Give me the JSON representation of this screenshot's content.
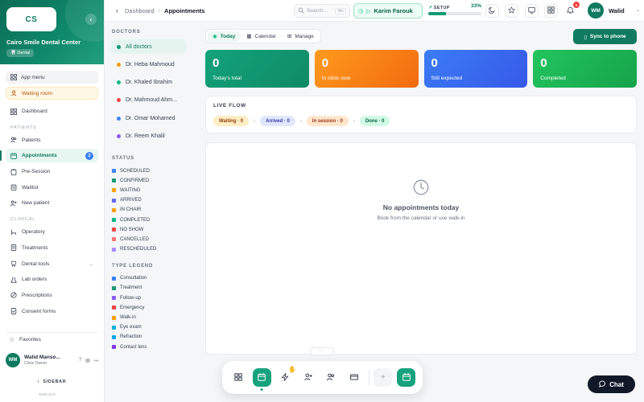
{
  "brand": {
    "logo_initials": "CS",
    "clinic_name": "Cairo Smile Dental Center",
    "badge": "Dental"
  },
  "sidebar": {
    "app_menu": "App menu",
    "waiting_room": "Waiting room",
    "dashboard": "Dashboard",
    "section_patients": "PATIENTS",
    "patients": "Patients",
    "appointments": "Appointments",
    "appointments_count": "2",
    "pre_session": "Pre-Session",
    "waitlist": "Waitlist",
    "new_patient": "New patient",
    "section_clinical": "CLINICAL",
    "operatory": "Operatory",
    "treatments": "Treatments",
    "dental_tools": "Dental tools",
    "lab_orders": "Lab orders",
    "prescriptions": "Prescriptions",
    "consent_forms": "Consent forms",
    "favorites": "Favorites",
    "user_initials": "WM",
    "user_name": "Walid Manso...",
    "user_role": "Clinic Owner",
    "sidebar_toggle": "SIDEBAR",
    "version": "Geek v3.0"
  },
  "topbar": {
    "breadcrumb_parent": "Dashboard",
    "breadcrumb_current": "Appointments",
    "search_placeholder": "Search...",
    "search_shortcut": "⌘K",
    "active_patient": "Karim Farouk",
    "setup_label": "SETUP",
    "setup_percent_text": "33%",
    "setup_percent": 33,
    "notifications_count": "6",
    "user_initials": "WM",
    "user_name": "Walid"
  },
  "filters": {
    "doctors_title": "DOCTORS",
    "doctors": [
      {
        "name": "All doctors",
        "color": "#0f9b72"
      },
      {
        "name": "Dr. Heba Mahmoud",
        "color": "#f59e0b"
      },
      {
        "name": "Dr. Khaled Ibrahim",
        "color": "#10b981"
      },
      {
        "name": "Dr. Mahmoud Ahm...",
        "color": "#ef4444"
      },
      {
        "name": "Dr. Omar Mohamed",
        "color": "#3b82f6"
      },
      {
        "name": "Dr. Reem Khalil",
        "color": "#8b5cf6"
      }
    ],
    "status_title": "STATUS",
    "statuses": [
      {
        "label": "SCHEDULED",
        "color": "#3b82f6"
      },
      {
        "label": "CONFIRMED",
        "color": "#0f9b72"
      },
      {
        "label": "WAITING",
        "color": "#f59e0b"
      },
      {
        "label": "ARRIVED",
        "color": "#6366f1"
      },
      {
        "label": "IN CHAIR",
        "color": "#f59e0b"
      },
      {
        "label": "COMPLETED",
        "color": "#10b981"
      },
      {
        "label": "NO SHOW",
        "color": "#ef4444"
      },
      {
        "label": "CANCELLED",
        "color": "#f87171"
      },
      {
        "label": "RESCHEDULED",
        "color": "#a78bfa"
      }
    ],
    "type_title": "TYPE LEGEND",
    "types": [
      {
        "label": "Consultation",
        "color": "#3b82f6"
      },
      {
        "label": "Treatment",
        "color": "#0f9b72"
      },
      {
        "label": "Follow-up",
        "color": "#8b5cf6"
      },
      {
        "label": "Emergency",
        "color": "#ef4444"
      },
      {
        "label": "Walk-in",
        "color": "#f59e0b"
      },
      {
        "label": "Eye exam",
        "color": "#06b6d4"
      },
      {
        "label": "Refraction",
        "color": "#0ea5e9"
      },
      {
        "label": "Contact lens",
        "color": "#7c3aed"
      }
    ]
  },
  "main": {
    "tabs": {
      "today": "Today",
      "calendar": "Calendar",
      "manage": "Manage"
    },
    "sync_button": "Sync to phone",
    "stats": [
      {
        "value": "0",
        "label": "Today's total"
      },
      {
        "value": "0",
        "label": "In clinic now"
      },
      {
        "value": "0",
        "label": "Still expected"
      },
      {
        "value": "0",
        "label": "Completed"
      }
    ],
    "live_flow_title": "LIVE FLOW",
    "flow": {
      "waiting": "Waiting · 0",
      "arrived": "Arrived · 0",
      "in_session": "In session · 0",
      "done": "Done · 0"
    },
    "empty_title": "No appointments today",
    "empty_subtitle": "Book from the calendar or use walk-in",
    "grip_label": ":::"
  },
  "chat": {
    "label": "Chat"
  }
}
